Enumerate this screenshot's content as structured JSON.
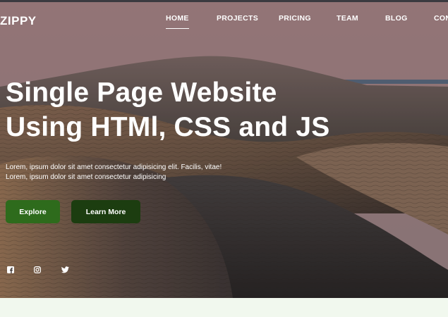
{
  "brand": {
    "name": "ZIPPY"
  },
  "nav": {
    "items": [
      {
        "label": "HOME",
        "active": true
      },
      {
        "label": "PROJECTS",
        "active": false
      },
      {
        "label": "PRICING",
        "active": false
      },
      {
        "label": "TEAM",
        "active": false
      },
      {
        "label": "BLOG",
        "active": false
      },
      {
        "label": "CON",
        "active": false
      }
    ]
  },
  "hero": {
    "headline_line1": "Single Page Website",
    "headline_line2": "Using HTMl, CSS and JS",
    "tagline_line1": "Lorem, ipsum dolor sit amet consectetur adipisicing elit. Facilis, vitae!",
    "tagline_line2": "Lorem, ipsum dolor sit amet consectetur adipisicing",
    "primary_button": "Explore",
    "secondary_button": "Learn More"
  },
  "social": {
    "icons": [
      "facebook-icon",
      "instagram-icon",
      "twitter-icon"
    ]
  },
  "colors": {
    "primary_button": "#2e6b1c",
    "secondary_button": "#1c3d10",
    "text": "#ffffff",
    "footer_background": "#f1f8ee"
  }
}
